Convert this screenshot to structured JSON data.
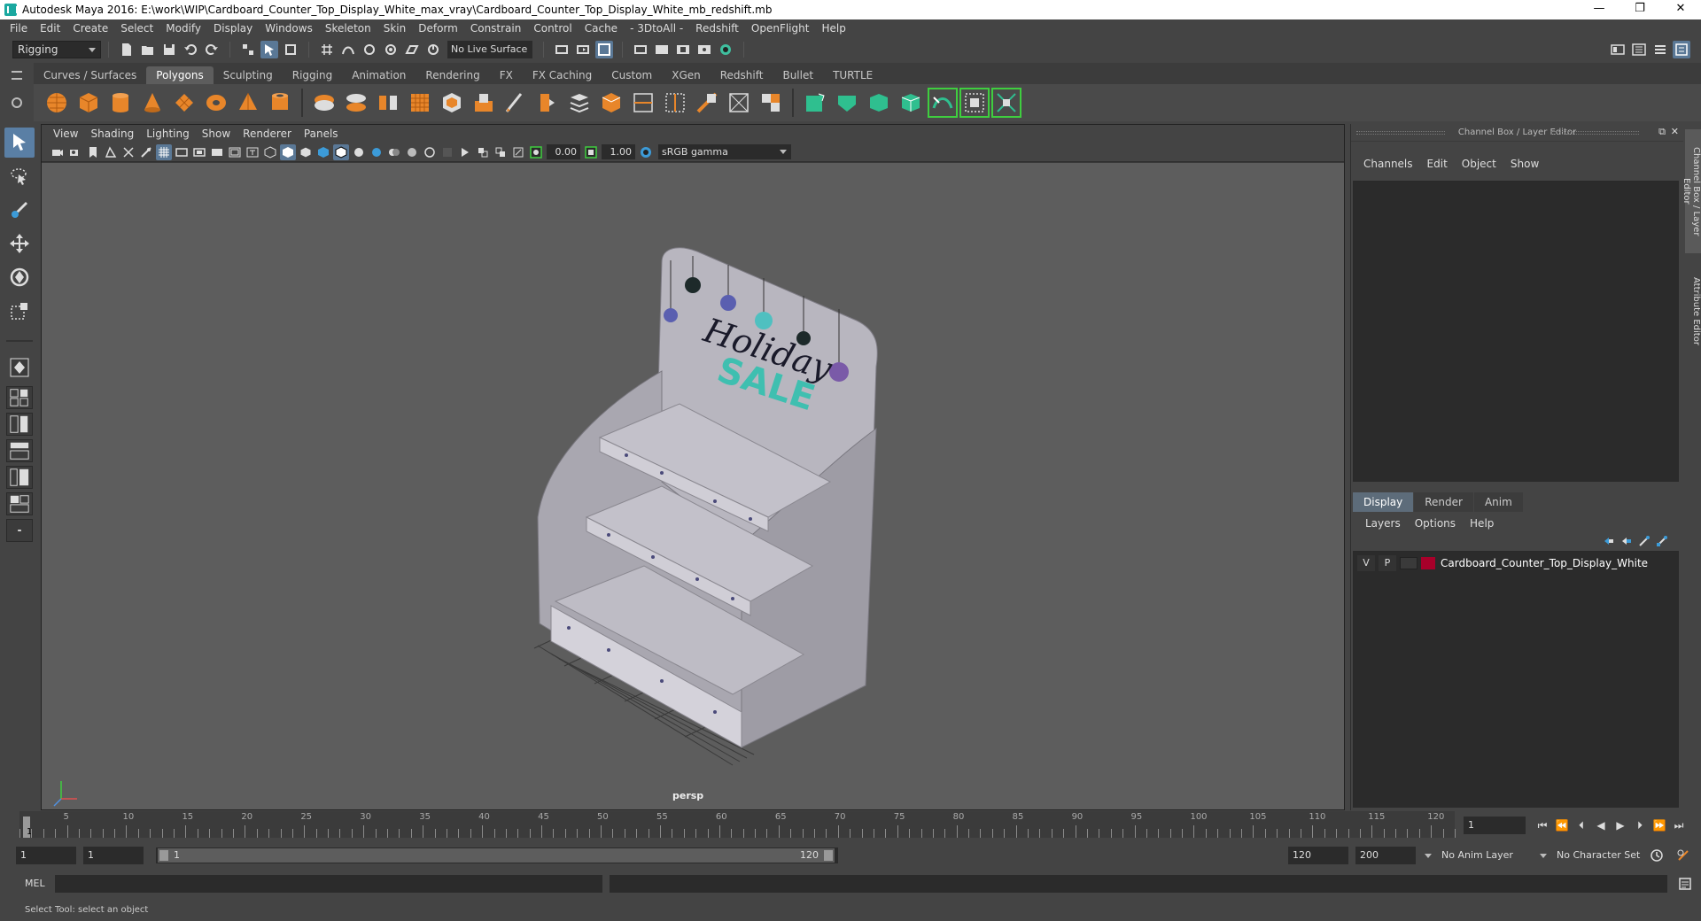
{
  "window": {
    "title": "Autodesk Maya 2016: E:\\work\\WIP\\Cardboard_Counter_Top_Display_White_max_vray\\Cardboard_Counter_Top_Display_White_mb_redshift.mb",
    "minimize": "—",
    "restore": "❐",
    "close": "✕"
  },
  "menubar": [
    "File",
    "Edit",
    "Create",
    "Select",
    "Modify",
    "Display",
    "Windows",
    "Skeleton",
    "Skin",
    "Deform",
    "Constrain",
    "Control",
    "Cache",
    "- 3DtoAll -",
    "Redshift",
    "OpenFlight",
    "Help"
  ],
  "statusline": {
    "mode": "Rigging",
    "live_surface": "No Live Surface"
  },
  "shelf": {
    "tabs": [
      "Curves / Surfaces",
      "Polygons",
      "Sculpting",
      "Rigging",
      "Animation",
      "Rendering",
      "FX",
      "FX Caching",
      "Custom",
      "XGen",
      "Redshift",
      "Bullet",
      "TURTLE"
    ],
    "active_tab": "Polygons"
  },
  "viewport": {
    "menus": [
      "View",
      "Shading",
      "Lighting",
      "Show",
      "Renderer",
      "Panels"
    ],
    "exposure": "0.00",
    "gamma": "1.00",
    "color_space": "sRGB gamma",
    "camera_label": "persp",
    "sign_line1": "Holiday",
    "sign_line2": "SALE"
  },
  "channel_box": {
    "header": "Channel Box / Layer Editor",
    "menus": [
      "Channels",
      "Edit",
      "Object",
      "Show"
    ]
  },
  "layer_editor": {
    "tabs": [
      "Display",
      "Render",
      "Anim"
    ],
    "active_tab": "Display",
    "menus": [
      "Layers",
      "Options",
      "Help"
    ],
    "layers": [
      {
        "visible": "V",
        "playback": "P",
        "color": "#a8002a",
        "name": "Cardboard_Counter_Top_Display_White"
      }
    ]
  },
  "side_tabs": [
    "Channel Box / Layer Editor",
    "Attribute Editor"
  ],
  "timeslider": {
    "labels": [
      "5",
      "10",
      "15",
      "20",
      "25",
      "30",
      "35",
      "40",
      "45",
      "50",
      "55",
      "60",
      "65",
      "70",
      "75",
      "80",
      "85",
      "90",
      "95",
      "100",
      "105",
      "110",
      "115",
      "120"
    ],
    "current_frame_marker": "1",
    "current_frame": "1"
  },
  "rangeslider": {
    "start_frame": "1",
    "range_start": "1",
    "handle_start": "1",
    "handle_end": "120",
    "range_end": "120",
    "end_frame": "200",
    "anim_layer": "No Anim Layer",
    "character_set": "No Character Set"
  },
  "cmdline": {
    "label": "MEL"
  },
  "helpline": {
    "text": "Select Tool: select an object"
  }
}
